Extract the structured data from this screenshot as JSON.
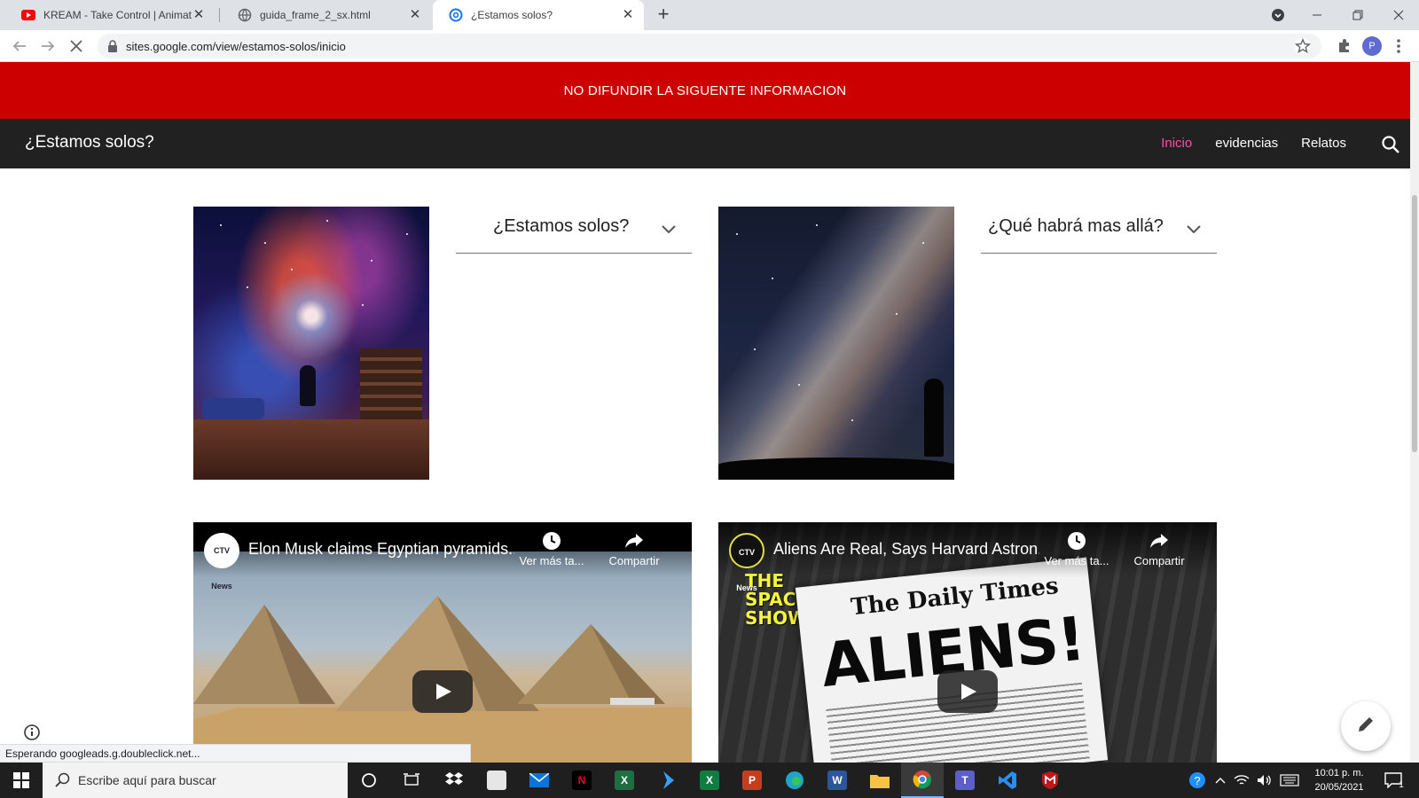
{
  "browser": {
    "tabs": [
      {
        "title": "KREAM - Take Control | Animated",
        "favicon": "youtube-icon"
      },
      {
        "title": "guida_frame_2_sx.html",
        "favicon": "globe-icon"
      },
      {
        "title": "¿Estamos solos?",
        "favicon": "google-sites-icon",
        "active": true
      }
    ],
    "url": "sites.google.com/view/estamos-solos/inicio",
    "profile_initial": "P",
    "status_text": "Esperando googleads.g.doubleclick.net..."
  },
  "site": {
    "announcement": "NO DIFUNDIR LA SIGUENTE INFORMACION",
    "title": "¿Estamos solos?",
    "nav": [
      {
        "label": "Inicio",
        "active": true
      },
      {
        "label": "evidencias"
      },
      {
        "label": "Relatos"
      }
    ],
    "accent_color": "#ff4fa0",
    "banner_color": "#cc0000",
    "header_color": "#212121"
  },
  "content": {
    "dropdowns": [
      {
        "label": "¿Estamos solos?"
      },
      {
        "label": "¿Qué habrá mas allá?"
      }
    ],
    "videos": [
      {
        "title": "Elon Musk claims Egyptian pyramids...",
        "channel": "CTV News",
        "watch_later": "Ver más ta...",
        "share": "Compartir"
      },
      {
        "title": "Aliens Are Real, Says Harvard Astron...",
        "channel": "CTV News",
        "watch_later": "Ver más ta...",
        "share": "Compartir",
        "thumb_show": "THE SPACE SHOW",
        "thumb_masthead": "The Daily Times",
        "thumb_headline": "ALIENS!"
      }
    ]
  },
  "taskbar": {
    "search_placeholder": "Escribe aquí para buscar",
    "time": "10:01 p. m.",
    "date": "20/05/2021",
    "notification_count": "1"
  }
}
